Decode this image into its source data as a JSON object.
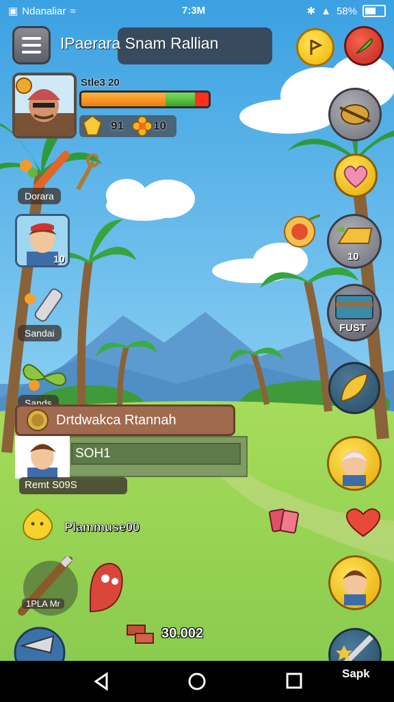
{
  "status_bar": {
    "app_label": "Ndanaliar",
    "time": "7:3M",
    "battery": "58%"
  },
  "header": {
    "title": "IPaerara Snam Rallian"
  },
  "player": {
    "level": "Stle3 20",
    "hp_fraction": 0.66,
    "xp_fraction": 0.23,
    "gems": "91",
    "flowers": "10"
  },
  "left_menu": {
    "item1": "Dorara",
    "item2_count": "10",
    "item3": "Sandai",
    "item4": "Sands"
  },
  "chat": {
    "banner": "Drtdwakca Rtannah",
    "input_value": "SOH1",
    "sub_label": "Remt S09S"
  },
  "gold": {
    "label": "Plammuse00"
  },
  "coins": {
    "value": "30.002"
  },
  "weapon": {
    "label": "1PLA Mr"
  },
  "right_menu": {
    "gold_count": "10",
    "chest_label": "FUST"
  },
  "sapk": {
    "label": "Sapk"
  },
  "colors": {
    "sky": "#5bb6ea",
    "grass": "#8ccf4f",
    "accent": "#f0b200"
  }
}
